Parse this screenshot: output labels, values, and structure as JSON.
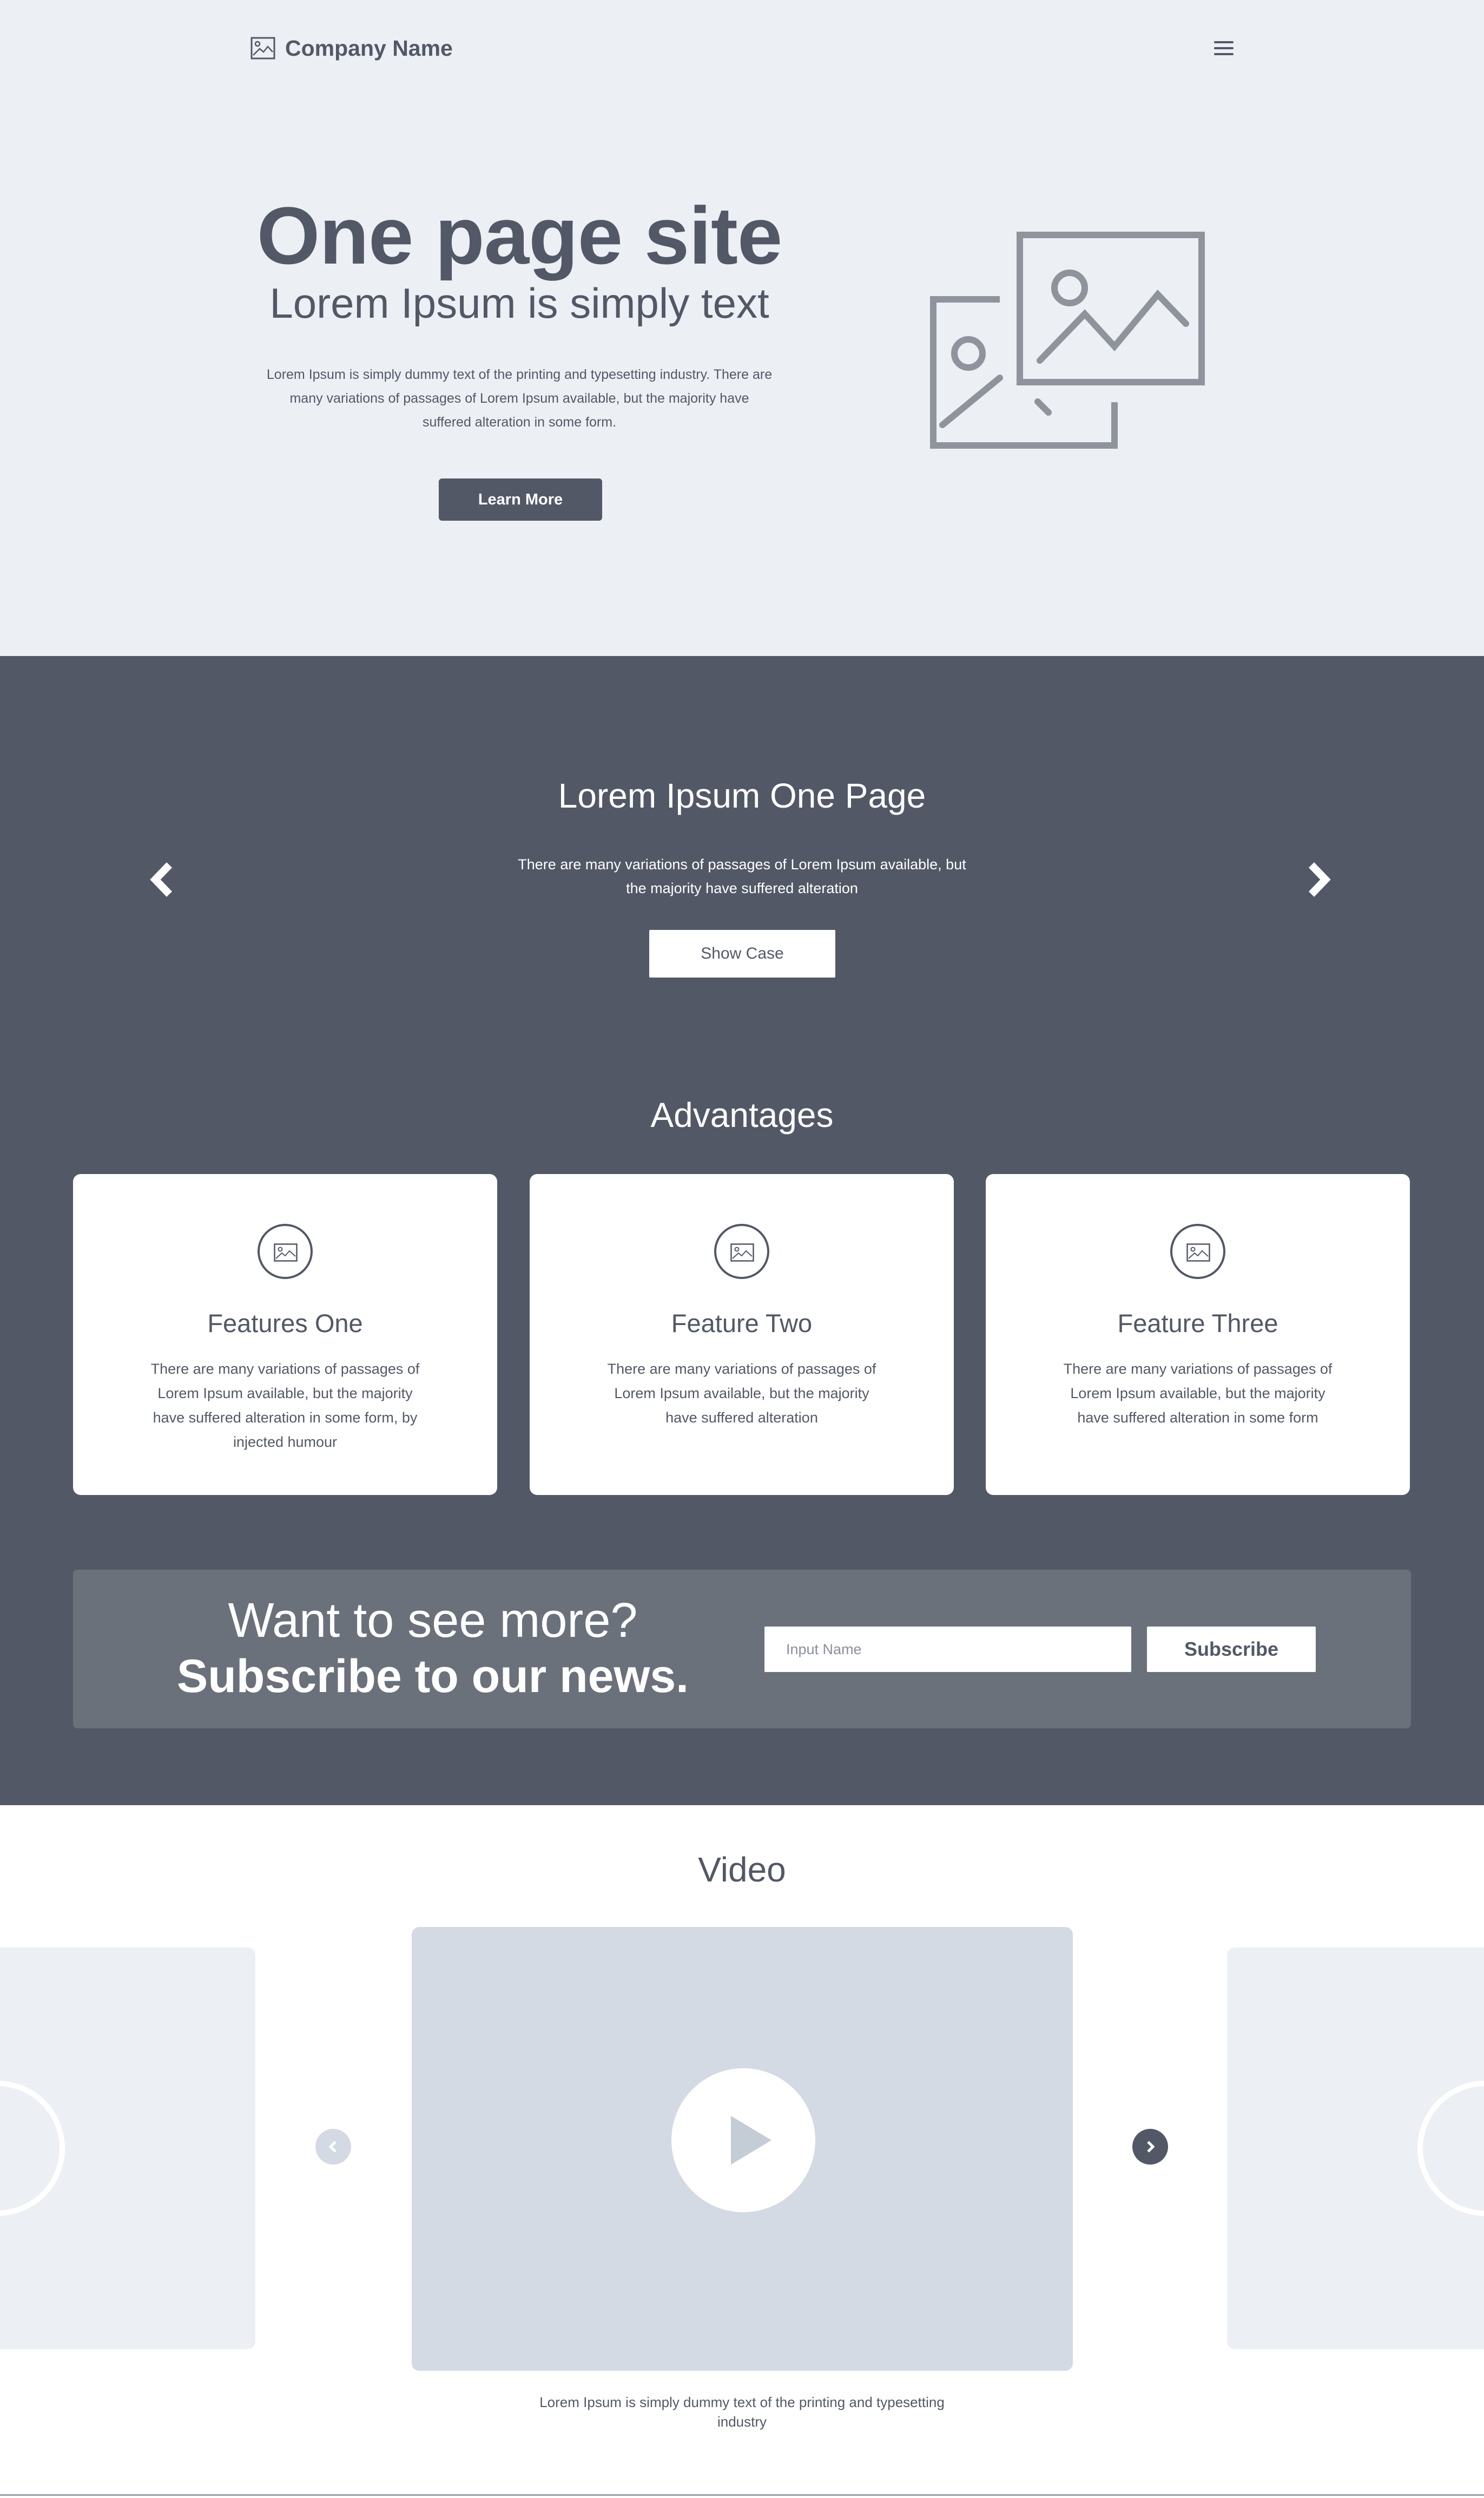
{
  "header": {
    "company_name": "Company Name",
    "logo_icon": "image-icon",
    "menu_icon": "hamburger-menu-icon"
  },
  "hero": {
    "title": "One page site",
    "subtitle": "Lorem Ipsum is simply text",
    "body": "Lorem Ipsum is simply dummy text of the printing and typesetting industry. There are many variations of passages of Lorem Ipsum available, but the majority have suffered alteration in some form.",
    "button_label": "Learn More",
    "image_icon": "image-placeholder-icon"
  },
  "carousel": {
    "title": "Lorem Ipsum One Page",
    "body": "There are many variations of passages of Lorem Ipsum available, but the majority have suffered alteration",
    "button_label": "Show Case",
    "prev_icon": "chevron-left-icon",
    "next_icon": "chevron-right-icon"
  },
  "advantages": {
    "title": "Advantages",
    "cards": [
      {
        "title": "Features One",
        "text": "There are many variations of passages of Lorem Ipsum available, but the majority have suffered alteration in some form, by injected humour",
        "icon": "image-icon"
      },
      {
        "title": "Feature Two",
        "text": "There are many variations of passages of Lorem Ipsum available, but the majority have suffered alteration",
        "icon": "image-icon"
      },
      {
        "title": "Feature Three",
        "text": "There are many variations of passages of Lorem Ipsum available, but the majority have suffered alteration in some form",
        "icon": "image-icon"
      }
    ]
  },
  "subscribe": {
    "line1": "Want to see more?",
    "line2": "Subscribe to our news.",
    "input_placeholder": "Input Name",
    "button_label": "Subscribe"
  },
  "video": {
    "title": "Video",
    "caption": "Lorem Ipsum is simply dummy text of the printing and typesetting industry",
    "play_icon": "play-icon",
    "prev_icon": "chevron-left-icon",
    "next_icon": "chevron-right-icon"
  },
  "colors": {
    "hero_bg": "#eceff4",
    "dark_bg": "#525866",
    "panel_bg": "#6b717b",
    "video_bg": "#d3dae3",
    "text": "#525866"
  }
}
